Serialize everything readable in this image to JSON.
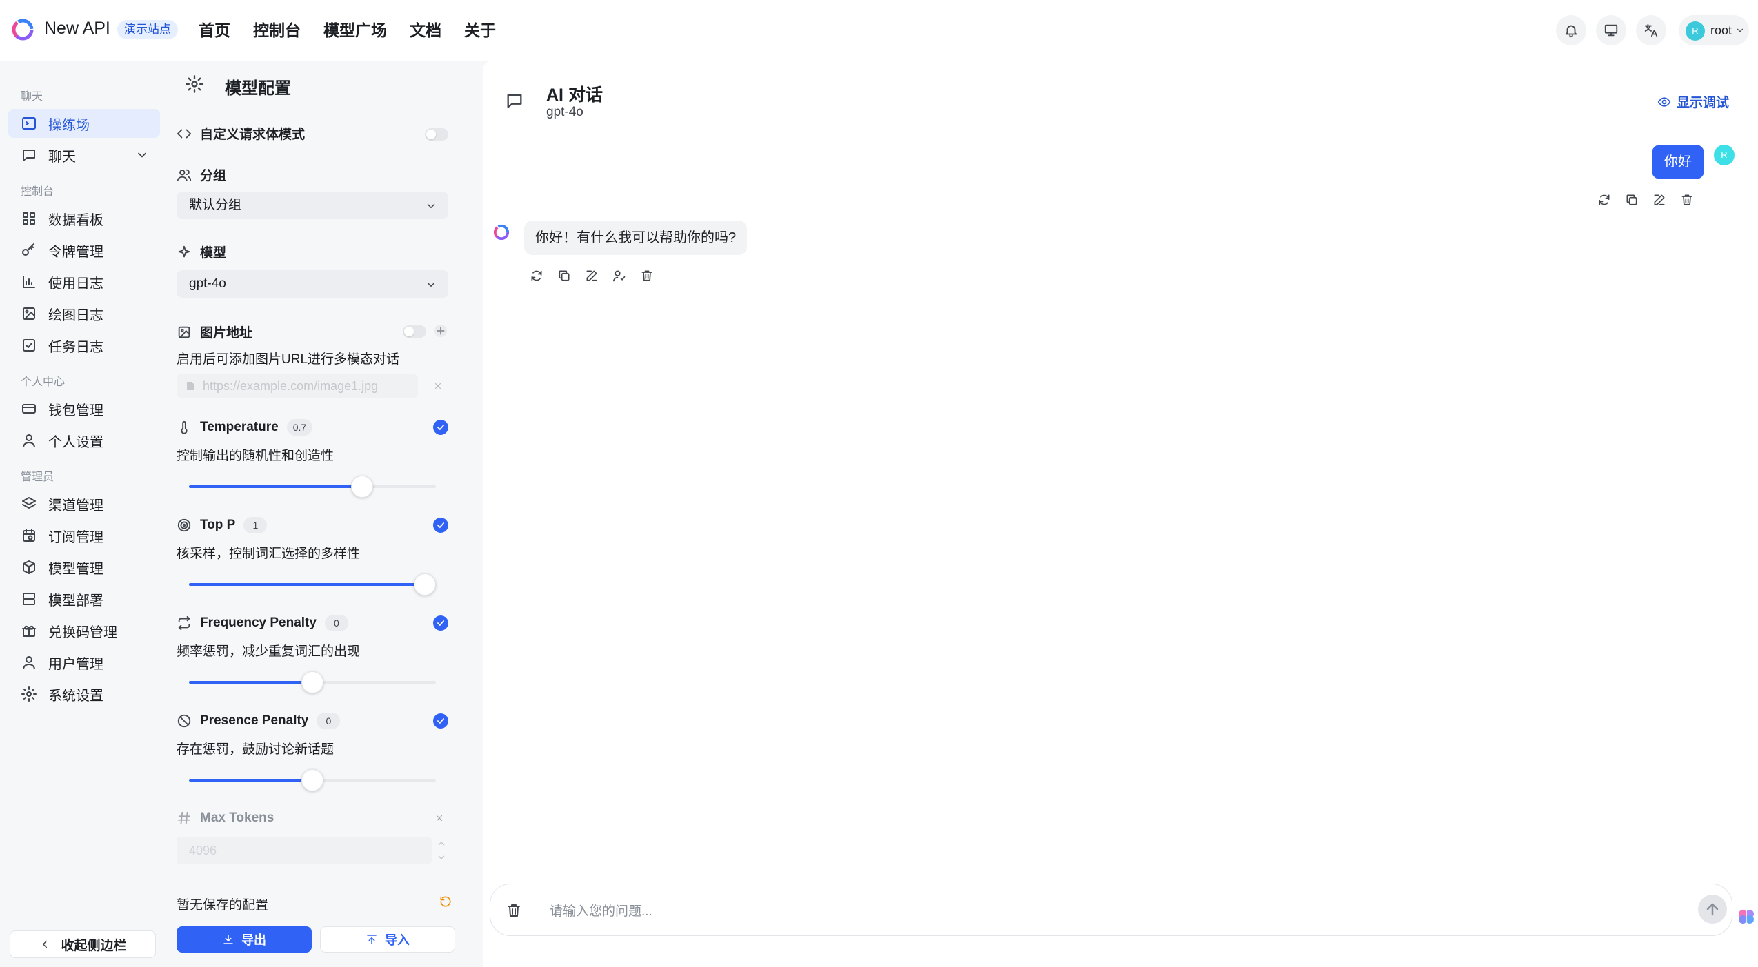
{
  "header": {
    "app_name": "New API",
    "demo_tag": "演示站点",
    "nav": [
      "首页",
      "控制台",
      "模型广场",
      "文档",
      "关于"
    ],
    "user": {
      "avatar_letter": "R",
      "name": "root"
    }
  },
  "sidebar": {
    "sections": {
      "chat": "聊天",
      "console": "控制台",
      "personal": "个人中心",
      "admin": "管理员"
    },
    "items": {
      "playground": "操练场",
      "chat": "聊天",
      "dashboard": "数据看板",
      "tokens": "令牌管理",
      "usage_log": "使用日志",
      "draw_log": "绘图日志",
      "task_log": "任务日志",
      "wallet": "钱包管理",
      "personal_settings": "个人设置",
      "channels": "渠道管理",
      "subscriptions": "订阅管理",
      "models": "模型管理",
      "deploy": "模型部署",
      "redeem": "兑换码管理",
      "users": "用户管理",
      "system": "系统设置"
    },
    "collapse_label": "收起侧边栏"
  },
  "config": {
    "title": "模型配置",
    "custom_body_label": "自定义请求体模式",
    "group_label": "分组",
    "group_value": "默认分组",
    "model_label": "模型",
    "model_value": "gpt-4o",
    "image_label": "图片地址",
    "image_desc": "启用后可添加图片URL进行多模态对话",
    "image_placeholder": "https://example.com/image1.jpg",
    "temperature": {
      "label": "Temperature",
      "value": "0.7",
      "desc": "控制输出的随机性和创造性",
      "level": 0.7
    },
    "top_p": {
      "label": "Top P",
      "value": "1",
      "desc": "核采样，控制词汇选择的多样性",
      "level": 1.0
    },
    "frequency_penalty": {
      "label": "Frequency Penalty",
      "value": "0",
      "desc": "频率惩罚，减少重复词汇的出现",
      "level": 0.5
    },
    "presence_penalty": {
      "label": "Presence Penalty",
      "value": "0",
      "desc": "存在惩罚，鼓励讨论新话题",
      "level": 0.5
    },
    "max_tokens_label": "Max Tokens",
    "max_tokens_placeholder": "4096",
    "no_saved": "暂无保存的配置",
    "export_label": "导出",
    "import_label": "导入"
  },
  "chat": {
    "title": "AI 对话",
    "subtitle": "gpt-4o",
    "debug_label": "显示调试",
    "user_message": "你好",
    "user_avatar": "R",
    "bot_message": "你好！有什么我可以帮助你的吗?",
    "input_placeholder": "请输入您的问题..."
  },
  "colors": {
    "accent": "#3062f5",
    "active_bg": "#e4ecfd",
    "avatar": "#3bc9db"
  }
}
